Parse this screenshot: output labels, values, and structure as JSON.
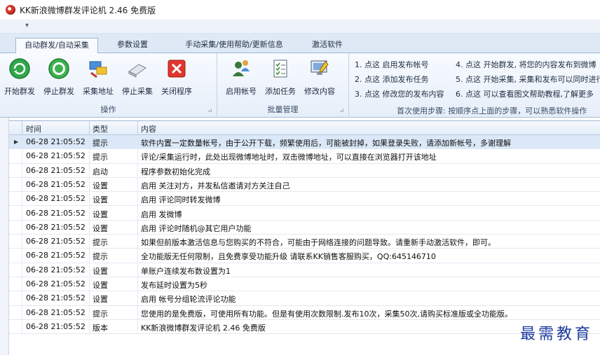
{
  "window": {
    "title": "KK新浪微博群发评论机 2.46  免费版"
  },
  "qat": {
    "arrow": "▾"
  },
  "tabs": [
    "自动群发/自动采集",
    "参数设置",
    "手动采集/使用帮助/更新信息",
    "激活软件"
  ],
  "ribbon": {
    "groups": [
      {
        "label": "操作",
        "buttons": [
          "开始群发",
          "停止群发",
          "采集地址",
          "停止采集",
          "关闭程序"
        ]
      },
      {
        "label": "批量管理",
        "buttons": [
          "启用帐号",
          "添加任务",
          "修改内容"
        ]
      }
    ],
    "launcher": "⊿",
    "steps": {
      "s1": "1. 点这 启用发布帐号",
      "s2": "2. 点这 添加发布任务",
      "s3": "3. 点这 修改您的发布内容",
      "s4": "4. 点这 开始群发, 将您的内容发布到微博",
      "s5": "5. 点这 开始采集, 采集和发布可以同时进行",
      "s6": "6. 点这 可以查看图文帮助教程,了解更多",
      "footer": "首次使用步骤:  按顺序点上面的步骤，可以熟悉软件操作"
    }
  },
  "log": {
    "columns": [
      "时间",
      "类型",
      "内容"
    ],
    "selected_marker": "▶",
    "rows": [
      [
        "06-28 21:05:52",
        "提示",
        "软件内置一定数量帐号，由于公开下载，频繁使用后，可能被封掉，如果登录失败，请添加新帐号，多谢理解"
      ],
      [
        "06-28 21:05:52",
        "提示",
        "评论/采集运行时，此处出现微博地址时，双击微博地址，可以直接在浏览器打开该地址"
      ],
      [
        "06-28 21:05:52",
        "启动",
        "程序参数初始化完成"
      ],
      [
        "06-28 21:05:52",
        "设置",
        "启用 关注对方，并发私信邀请对方关注自己"
      ],
      [
        "06-28 21:05:52",
        "设置",
        "启用 评论同时转发微博"
      ],
      [
        "06-28 21:05:52",
        "设置",
        "启用 发微博"
      ],
      [
        "06-28 21:05:52",
        "设置",
        "启用 评论时随机@其它用户功能"
      ],
      [
        "06-28 21:05:52",
        "提示",
        "如果但前版本激活信息与您购买的不符合，可能由于网络连接的问题导致。请重新手动激活软件，即可。"
      ],
      [
        "06-28 21:05:52",
        "提示",
        "全功能版无任何限制，且免费享受功能升级 请联系KK销售客服购买，QQ:645146710"
      ],
      [
        "06-28 21:05:52",
        "设置",
        "单账户连续发布数设置为1"
      ],
      [
        "06-28 21:05:52",
        "设置",
        "发布延时设置为5秒"
      ],
      [
        "06-28 21:05:52",
        "设置",
        "启用 帐号分组轮流评论功能"
      ],
      [
        "06-28 21:05:52",
        "提示",
        "您使用的是免费版，可使用所有功能。但是有使用次数限制.发布10次，采集50次,请购买标准版或全功能版。"
      ],
      [
        "06-28 21:05:52",
        "版本",
        "KK新浪微博群发评论机 2.46  免费版"
      ]
    ]
  },
  "watermark": "最需教育"
}
